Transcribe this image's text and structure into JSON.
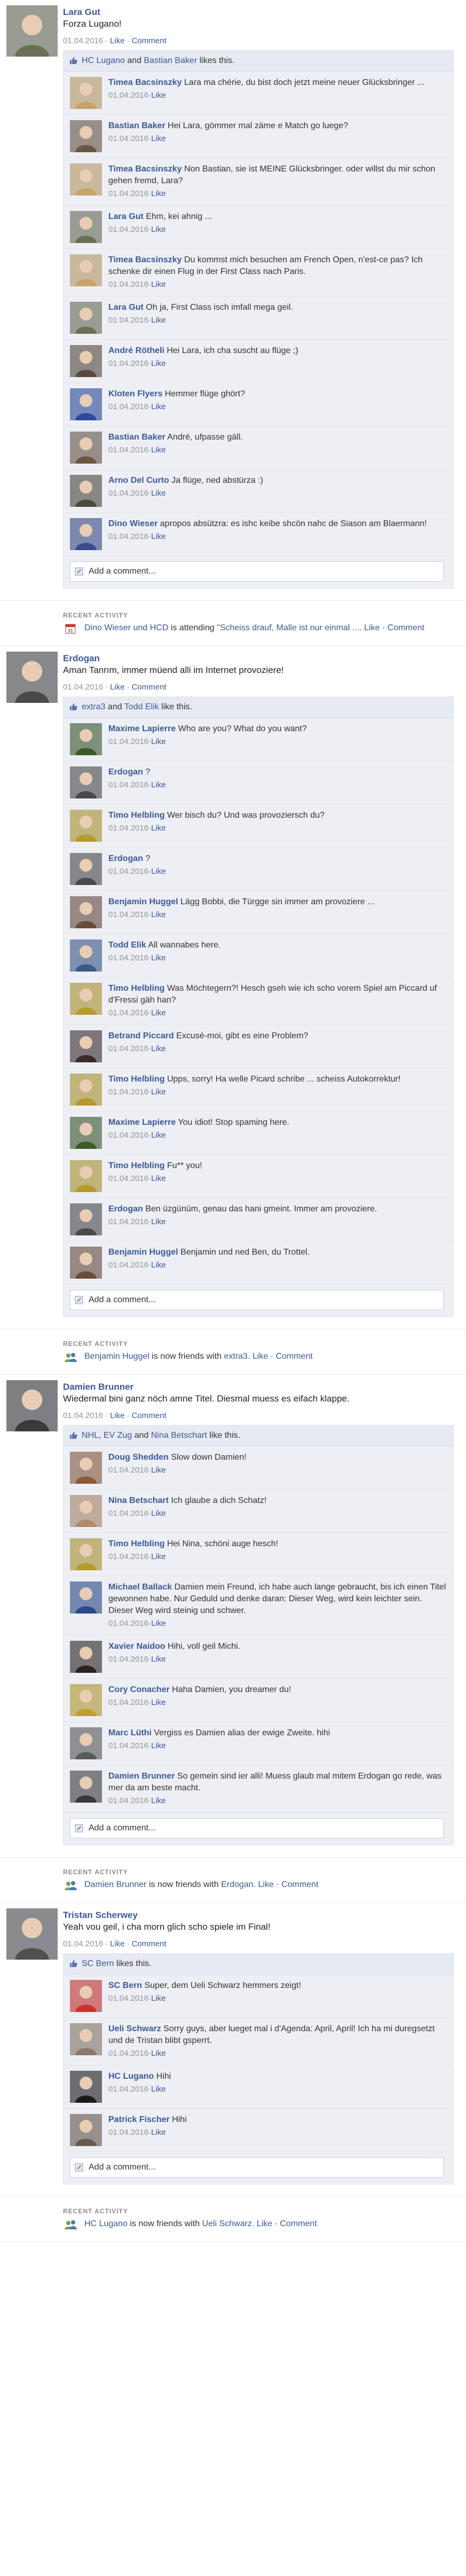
{
  "feed": [
    {
      "kind": "post",
      "author": "Lara Gut",
      "text": "Forza Lugano!",
      "time": "01.04.2016",
      "actions": [
        "Like",
        "Comment"
      ],
      "avatar_color": "#6b6f55",
      "likes": {
        "names": [
          "HC Lugano",
          "Bastian Baker"
        ],
        "joiner": "and",
        "suffix": "likes this."
      },
      "comments": [
        {
          "author": "Timea Bacsinszky",
          "text": "Lara ma chérie, du bist doch jetzt meine neuer Glücksbringer ...",
          "time": "01.04.2016",
          "action": "Like",
          "avatar_color": "#c7a36a"
        },
        {
          "author": "Bastian Baker",
          "text": "Hei Lara, gömmer mal zäme e Match go luege?",
          "time": "01.04.2016",
          "action": "Like",
          "avatar_color": "#6b5545"
        },
        {
          "author": "Timea Bacsinszky",
          "text": "Non Bastian, sie ist MEINE Glücksbringer. oder willst du mir schon gehen fremd, Lara?",
          "time": "01.04.2016",
          "action": "Like",
          "avatar_color": "#c7a36a"
        },
        {
          "author": "Lara Gut",
          "text": "Ehm, kei ahnig ...",
          "time": "01.04.2016",
          "action": "Like",
          "avatar_color": "#6b6f55"
        },
        {
          "author": "Timea Bacsinszky",
          "text": "Du kommst mich besuchen am French Open, n'est-ce pas? Ich schenke dir einen Flug in der First Class nach Paris.",
          "time": "01.04.2016",
          "action": "Like",
          "avatar_color": "#c7a36a"
        },
        {
          "author": "Lara Gut",
          "text": "Oh ja, First Class isch imfall mega geil.",
          "time": "01.04.2016",
          "action": "Like",
          "avatar_color": "#6b6f55"
        },
        {
          "author": "André Rötheli",
          "text": "Hei Lara, ich cha suscht au flüge ;)",
          "time": "01.04.2016",
          "action": "Like",
          "avatar_color": "#5a4a3e"
        },
        {
          "author": "Kloten Flyers",
          "text": "Hemmer flüge ghört?",
          "time": "01.04.2016",
          "action": "Like",
          "avatar_color": "#2b4aa0"
        },
        {
          "author": "Bastian Baker",
          "text": "André, ufpasse gäll.",
          "time": "01.04.2016",
          "action": "Like",
          "avatar_color": "#6b5545"
        },
        {
          "author": "Arno Del Curto",
          "text": "Ja flüge, ned abstürza :)",
          "time": "01.04.2016",
          "action": "Like",
          "avatar_color": "#4c4a3a"
        },
        {
          "author": "Dino Wieser",
          "text": "apropos absützra: es ishc keibe shcön nahc de Siason am Blaermann!",
          "time": "01.04.2016",
          "action": "Like",
          "avatar_color": "#3b4a8a"
        }
      ],
      "add_comment": "Add a comment..."
    },
    {
      "kind": "activity",
      "title": "RECENT ACTIVITY",
      "icon": "calendar-icon",
      "subject": "Dino Wieser und HCD",
      "verb": "is attending",
      "object": "\"Scheiss drauf, Malle ist nur einmal ....",
      "actions": [
        "Like",
        "Comment"
      ]
    },
    {
      "kind": "post",
      "author": "Erdogan",
      "text": "Aman Tanrım, immer müend alli im Internet provoziere!",
      "time": "01.04.2016",
      "actions": [
        "Like",
        "Comment"
      ],
      "avatar_color": "#4a4a4a",
      "likes": {
        "names": [
          "extra3",
          "Todd Elik"
        ],
        "joiner": "and",
        "suffix": "like this."
      },
      "comments": [
        {
          "author": "Maxime Lapierre",
          "text": "Who are you? What do you want?",
          "time": "01.04.2016",
          "action": "Like",
          "avatar_color": "#3c5a2a"
        },
        {
          "author": "Erdogan",
          "text": "?",
          "time": "01.04.2016",
          "action": "Like",
          "avatar_color": "#4a4a4a"
        },
        {
          "author": "Timo Helbling",
          "text": "Wer bisch du? Und was provoziersch du?",
          "time": "01.04.2016",
          "action": "Like",
          "avatar_color": "#b79a2a"
        },
        {
          "author": "Erdogan",
          "text": "?",
          "time": "01.04.2016",
          "action": "Like",
          "avatar_color": "#4a4a4a"
        },
        {
          "author": "Benjamin Huggel",
          "text": "Lägg Bobbi, die Türgge sin immer am provoziere ...",
          "time": "01.04.2016",
          "action": "Like",
          "avatar_color": "#6a4a3a"
        },
        {
          "author": "Todd Elik",
          "text": "All wannabes here.",
          "time": "01.04.2016",
          "action": "Like",
          "avatar_color": "#3a5a8a"
        },
        {
          "author": "Timo Helbling",
          "text": "Was Möchtegern?! Hesch gseh wie ich scho vorem Spiel am Piccard uf d'Fressi gäh han?",
          "time": "01.04.2016",
          "action": "Like",
          "avatar_color": "#b79a2a"
        },
        {
          "author": "Betrand Piccard",
          "text": "Excusé-moi, gibt es eine Problem?",
          "time": "01.04.2016",
          "action": "Like",
          "avatar_color": "#3a2a2a"
        },
        {
          "author": "Timo Helbling",
          "text": "Upps, sorry! Ha welle Picard schribe ... scheiss Autokorrektur!",
          "time": "01.04.2016",
          "action": "Like",
          "avatar_color": "#b79a2a"
        },
        {
          "author": "Maxime Lapierre",
          "text": "You idiot! Stop spaming here.",
          "time": "01.04.2016",
          "action": "Like",
          "avatar_color": "#3c5a2a"
        },
        {
          "author": "Timo Helbling",
          "text": "Fu** you!",
          "time": "01.04.2016",
          "action": "Like",
          "avatar_color": "#b79a2a"
        },
        {
          "author": "Erdogan",
          "text": "Ben üzgünüm, genau das hani gmeint. Immer am provoziere.",
          "time": "01.04.2016",
          "action": "Like",
          "avatar_color": "#4a4a4a"
        },
        {
          "author": "Benjamin Huggel",
          "text": "Benjamin und ned Ben, du Trottel.",
          "time": "01.04.2016",
          "action": "Like",
          "avatar_color": "#6a4a3a"
        }
      ],
      "add_comment": "Add a comment..."
    },
    {
      "kind": "activity",
      "title": "RECENT ACTIVITY",
      "icon": "friends-icon",
      "subject": "Benjamin Huggel",
      "verb": "is now friends with",
      "object": "extra3.",
      "actions": [
        "Like",
        "Comment"
      ]
    },
    {
      "kind": "post",
      "author": "Damien Brunner",
      "text": "Wiedermal bini ganz nöch amne Titel. Diesmal muess es eifach klappe.",
      "time": "01.04.2016",
      "actions": [
        "Like",
        "Comment"
      ],
      "avatar_color": "#3a3a3a",
      "likes": {
        "names": [
          "NHL",
          "EV Zug",
          "Nina Betschart"
        ],
        "joiner": "and",
        "suffix": "like this."
      },
      "comments": [
        {
          "author": "Doug Shedden",
          "text": "Slow down Damien!",
          "time": "01.04.2016",
          "action": "Like",
          "avatar_color": "#8a5a3a"
        },
        {
          "author": "Nina Betschart",
          "text": "Ich glaube a dich Schatz!",
          "time": "01.04.2016",
          "action": "Like",
          "avatar_color": "#b08a6a"
        },
        {
          "author": "Timo Helbling",
          "text": "Hei Nina, schöni auge hesch!",
          "time": "01.04.2016",
          "action": "Like",
          "avatar_color": "#b79a2a"
        },
        {
          "author": "Michael Ballack",
          "text": "Damien mein Freund, ich habe auch lange gebraucht, bis ich einen Titel gewonnen habe. Nur Geduld und denke daran: Dieser Weg, wird kein leichter sein. Dieser Weg wird steinig und schwer.",
          "time": "01.04.2016",
          "action": "Like",
          "avatar_color": "#2a4a8a"
        },
        {
          "author": "Xavier Naidoo",
          "text": "Hihi, voll geil Michi.",
          "time": "01.04.2016",
          "action": "Like",
          "avatar_color": "#2a2220"
        },
        {
          "author": "Cory Conacher",
          "text": "Haha Damien, you dreamer du!",
          "time": "01.04.2016",
          "action": "Like",
          "avatar_color": "#c0a02a"
        },
        {
          "author": "Marc Lüthi",
          "text": "Vergiss es Damien alias der ewige Zweite. hihi",
          "time": "01.04.2016",
          "action": "Like",
          "avatar_color": "#5a5a5a"
        },
        {
          "author": "Damien Brunner",
          "text": "So gemein sind ier alli! Muess glaub mal mitem Erdogan go rede, was mer da am beste macht.",
          "time": "01.04.2016",
          "action": "Like",
          "avatar_color": "#3a3a3a"
        }
      ],
      "add_comment": "Add a comment..."
    },
    {
      "kind": "activity",
      "title": "RECENT ACTIVITY",
      "icon": "friends-icon",
      "subject": "Damien Brunner",
      "verb": "is now friends with",
      "object": "Erdogan.",
      "actions": [
        "Like",
        "Comment"
      ]
    },
    {
      "kind": "post",
      "author": "Tristan Scherwey",
      "text": "Yeah vou geil, i cha morn glich scho spiele im Final!",
      "time": "01.04.2016",
      "actions": [
        "Like",
        "Comment"
      ],
      "avatar_color": "#505050",
      "likes": {
        "names": [
          "SC Bern"
        ],
        "joiner": "",
        "suffix": "likes this."
      },
      "comments": [
        {
          "author": "SC Bern",
          "text": "Super, dem Ueli Schwarz hemmers zeigt!",
          "time": "01.04.2016",
          "action": "Like",
          "avatar_color": "#d0302a"
        },
        {
          "author": "Ueli Schwarz",
          "text": "Sorry guys, aber lueget mal i d'Agenda: April, April! Ich ha mi duregsetzt und de Tristan blibt gsperrt.",
          "time": "01.04.2016",
          "action": "Like",
          "avatar_color": "#8a7a6a"
        },
        {
          "author": "HC Lugano",
          "text": "Hihi",
          "time": "01.04.2016",
          "action": "Like",
          "avatar_color": "#1a1a1a"
        },
        {
          "author": "Patrick Fischer",
          "text": "Hihi",
          "time": "01.04.2016",
          "action": "Like",
          "avatar_color": "#6a5a4a"
        }
      ],
      "add_comment": "Add a comment..."
    },
    {
      "kind": "activity",
      "title": "RECENT ACTIVITY",
      "icon": "friends-icon",
      "subject": "HC Lugano",
      "verb": "is now friends with",
      "object": "Ueli Schwarz.",
      "actions": [
        "Like",
        "Comment"
      ]
    }
  ]
}
